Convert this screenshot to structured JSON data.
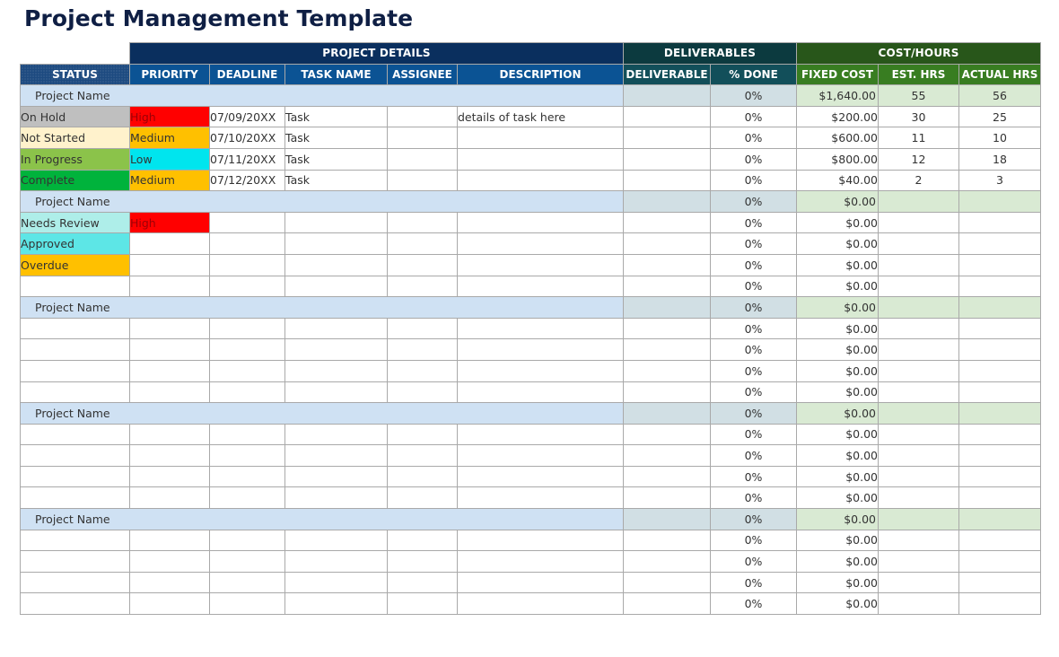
{
  "title": "Project Management Template",
  "group_headers": {
    "project_details": "PROJECT DETAILS",
    "deliverables": "DELIVERABLES",
    "cost_hours": "COST/HOURS"
  },
  "columns": {
    "status": "STATUS",
    "priority": "PRIORITY",
    "deadline": "DEADLINE",
    "task_name": "TASK NAME",
    "assignee": "ASSIGNEE",
    "description": "DESCRIPTION",
    "deliverable": "DELIVERABLE",
    "pct_done": "% DONE",
    "fixed_cost": "FIXED COST",
    "est_hrs": "EST. HRS",
    "actual_hrs": "ACTUAL HRS"
  },
  "colors": {
    "status": {
      "On Hold": "#bfbfbf",
      "Not Started": "#fff2cc",
      "In Progress": "#8bc34a",
      "Complete": "#00b33c",
      "Needs Review": "#aeeee9",
      "Approved": "#5de6e6",
      "Overdue": "#ffc000"
    },
    "priority": {
      "High": "#ff0000",
      "Medium": "#ffc000",
      "Low": "#00e5ee"
    }
  },
  "projects": [
    {
      "name": "Project Name",
      "pct_done": "0%",
      "fixed_cost": "$1,640.00",
      "est_hrs": "55",
      "actual_hrs": "56",
      "tasks": [
        {
          "status": "On Hold",
          "priority": "High",
          "deadline": "07/09/20XX",
          "task_name": "Task",
          "assignee": "",
          "description": "details of task here",
          "deliverable": "",
          "pct_done": "0%",
          "fixed_cost": "$200.00",
          "est_hrs": "30",
          "actual_hrs": "25"
        },
        {
          "status": "Not Started",
          "priority": "Medium",
          "deadline": "07/10/20XX",
          "task_name": "Task",
          "assignee": "",
          "description": "",
          "deliverable": "",
          "pct_done": "0%",
          "fixed_cost": "$600.00",
          "est_hrs": "11",
          "actual_hrs": "10"
        },
        {
          "status": "In Progress",
          "priority": "Low",
          "deadline": "07/11/20XX",
          "task_name": "Task",
          "assignee": "",
          "description": "",
          "deliverable": "",
          "pct_done": "0%",
          "fixed_cost": "$800.00",
          "est_hrs": "12",
          "actual_hrs": "18"
        },
        {
          "status": "Complete",
          "priority": "Medium",
          "deadline": "07/12/20XX",
          "task_name": "Task",
          "assignee": "",
          "description": "",
          "deliverable": "",
          "pct_done": "0%",
          "fixed_cost": "$40.00",
          "est_hrs": "2",
          "actual_hrs": "3"
        }
      ]
    },
    {
      "name": "Project Name",
      "pct_done": "0%",
      "fixed_cost": "$0.00",
      "est_hrs": "",
      "actual_hrs": "",
      "tasks": [
        {
          "status": "Needs Review",
          "priority": "High",
          "deadline": "",
          "task_name": "",
          "assignee": "",
          "description": "",
          "deliverable": "",
          "pct_done": "0%",
          "fixed_cost": "$0.00",
          "est_hrs": "",
          "actual_hrs": ""
        },
        {
          "status": "Approved",
          "priority": "",
          "deadline": "",
          "task_name": "",
          "assignee": "",
          "description": "",
          "deliverable": "",
          "pct_done": "0%",
          "fixed_cost": "$0.00",
          "est_hrs": "",
          "actual_hrs": ""
        },
        {
          "status": "Overdue",
          "priority": "",
          "deadline": "",
          "task_name": "",
          "assignee": "",
          "description": "",
          "deliverable": "",
          "pct_done": "0%",
          "fixed_cost": "$0.00",
          "est_hrs": "",
          "actual_hrs": ""
        },
        {
          "status": "",
          "priority": "",
          "deadline": "",
          "task_name": "",
          "assignee": "",
          "description": "",
          "deliverable": "",
          "pct_done": "0%",
          "fixed_cost": "$0.00",
          "est_hrs": "",
          "actual_hrs": ""
        }
      ]
    },
    {
      "name": "Project Name",
      "pct_done": "0%",
      "fixed_cost": "$0.00",
      "est_hrs": "",
      "actual_hrs": "",
      "tasks": [
        {
          "status": "",
          "priority": "",
          "deadline": "",
          "task_name": "",
          "assignee": "",
          "description": "",
          "deliverable": "",
          "pct_done": "0%",
          "fixed_cost": "$0.00",
          "est_hrs": "",
          "actual_hrs": ""
        },
        {
          "status": "",
          "priority": "",
          "deadline": "",
          "task_name": "",
          "assignee": "",
          "description": "",
          "deliverable": "",
          "pct_done": "0%",
          "fixed_cost": "$0.00",
          "est_hrs": "",
          "actual_hrs": ""
        },
        {
          "status": "",
          "priority": "",
          "deadline": "",
          "task_name": "",
          "assignee": "",
          "description": "",
          "deliverable": "",
          "pct_done": "0%",
          "fixed_cost": "$0.00",
          "est_hrs": "",
          "actual_hrs": ""
        },
        {
          "status": "",
          "priority": "",
          "deadline": "",
          "task_name": "",
          "assignee": "",
          "description": "",
          "deliverable": "",
          "pct_done": "0%",
          "fixed_cost": "$0.00",
          "est_hrs": "",
          "actual_hrs": ""
        }
      ]
    },
    {
      "name": "Project Name",
      "pct_done": "0%",
      "fixed_cost": "$0.00",
      "est_hrs": "",
      "actual_hrs": "",
      "tasks": [
        {
          "status": "",
          "priority": "",
          "deadline": "",
          "task_name": "",
          "assignee": "",
          "description": "",
          "deliverable": "",
          "pct_done": "0%",
          "fixed_cost": "$0.00",
          "est_hrs": "",
          "actual_hrs": ""
        },
        {
          "status": "",
          "priority": "",
          "deadline": "",
          "task_name": "",
          "assignee": "",
          "description": "",
          "deliverable": "",
          "pct_done": "0%",
          "fixed_cost": "$0.00",
          "est_hrs": "",
          "actual_hrs": ""
        },
        {
          "status": "",
          "priority": "",
          "deadline": "",
          "task_name": "",
          "assignee": "",
          "description": "",
          "deliverable": "",
          "pct_done": "0%",
          "fixed_cost": "$0.00",
          "est_hrs": "",
          "actual_hrs": ""
        },
        {
          "status": "",
          "priority": "",
          "deadline": "",
          "task_name": "",
          "assignee": "",
          "description": "",
          "deliverable": "",
          "pct_done": "0%",
          "fixed_cost": "$0.00",
          "est_hrs": "",
          "actual_hrs": ""
        }
      ]
    },
    {
      "name": "Project Name",
      "pct_done": "0%",
      "fixed_cost": "$0.00",
      "est_hrs": "",
      "actual_hrs": "",
      "tasks": [
        {
          "status": "",
          "priority": "",
          "deadline": "",
          "task_name": "",
          "assignee": "",
          "description": "",
          "deliverable": "",
          "pct_done": "0%",
          "fixed_cost": "$0.00",
          "est_hrs": "",
          "actual_hrs": ""
        },
        {
          "status": "",
          "priority": "",
          "deadline": "",
          "task_name": "",
          "assignee": "",
          "description": "",
          "deliverable": "",
          "pct_done": "0%",
          "fixed_cost": "$0.00",
          "est_hrs": "",
          "actual_hrs": ""
        },
        {
          "status": "",
          "priority": "",
          "deadline": "",
          "task_name": "",
          "assignee": "",
          "description": "",
          "deliverable": "",
          "pct_done": "0%",
          "fixed_cost": "$0.00",
          "est_hrs": "",
          "actual_hrs": ""
        },
        {
          "status": "",
          "priority": "",
          "deadline": "",
          "task_name": "",
          "assignee": "",
          "description": "",
          "deliverable": "",
          "pct_done": "0%",
          "fixed_cost": "$0.00",
          "est_hrs": "",
          "actual_hrs": ""
        }
      ]
    }
  ]
}
